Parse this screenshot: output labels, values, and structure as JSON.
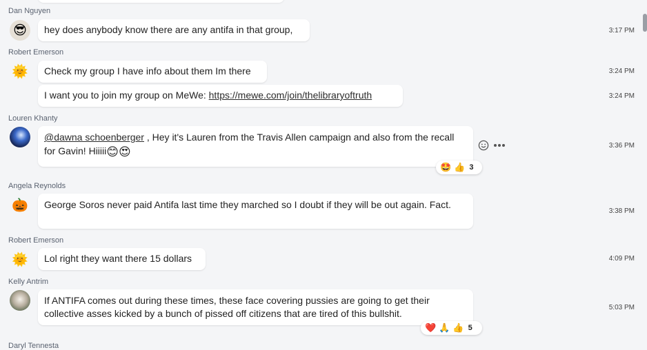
{
  "messages": [
    {
      "author": "Dan Nguyen",
      "avatar_icon": "sunglasses-face-icon",
      "text": "hey does anybody know there are any antifa in that group,",
      "time": "3:17 PM"
    },
    {
      "author": "Robert Emerson",
      "avatar_icon": "sun-face-icon",
      "text": "Check my group I have info about them Im there",
      "time": "3:24 PM"
    },
    {
      "author": "",
      "text_prefix": "I want you to join my group on MeWe: ",
      "link": "https://mewe.com/join/thelibraryoftruth",
      "time": "3:24 PM"
    },
    {
      "author": "Louren Khanty",
      "avatar_icon": "blue-portrait-icon",
      "mention": "@dawna schoenberger",
      "text_after_mention": " ,  Hey it's Lauren from the Travis Allen campaign and also from the recall for Gavin! Hiiiii",
      "inline_emojis": [
        "😊",
        "😍"
      ],
      "time": "3:36 PM",
      "reactions": {
        "emojis": [
          "🤩",
          "👍"
        ],
        "count": "3"
      }
    },
    {
      "author": "Angela Reynolds",
      "avatar_icon": "jack-o-lantern-icon",
      "text": "George Soros never paid Antifa last time they marched  so I doubt if they will be out  again. Fact.",
      "time": "3:38 PM"
    },
    {
      "author": "Robert Emerson",
      "avatar_icon": "sun-face-icon",
      "text": "Lol right they want there 15 dollars",
      "time": "4:09 PM"
    },
    {
      "author": "Kelly Antrim",
      "avatar_icon": "dog-photo-icon",
      "text": "If ANTIFA comes out during these times, these face covering pussies are going to get their collective asses kicked by a bunch of pissed off citizens that are tired of this bullshit.",
      "time": "5:03 PM",
      "reactions": {
        "emojis": [
          "❤️",
          "🙏",
          "👍"
        ],
        "count": "5"
      }
    },
    {
      "author": "Daryl Tennesta"
    }
  ],
  "icons": {
    "emoji_react": "smiley-outline-icon",
    "more": "more-dots-icon"
  }
}
